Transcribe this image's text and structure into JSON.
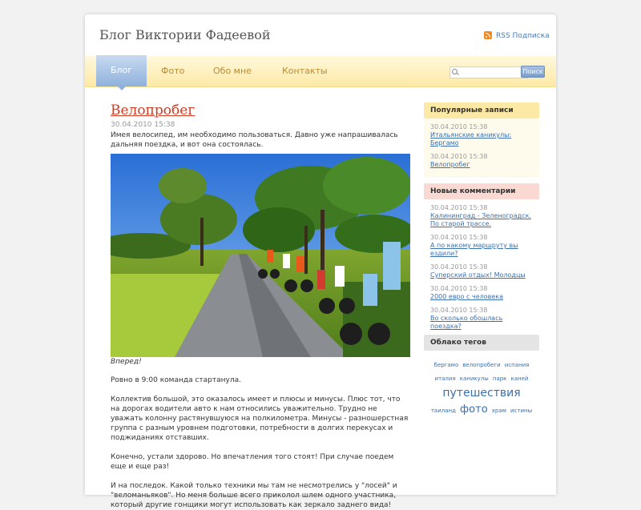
{
  "site": {
    "title": "Блог Виктории Фадеевой",
    "rss_label": "RSS Подписка"
  },
  "nav": {
    "items": [
      {
        "label": "Блог",
        "active": true
      },
      {
        "label": "Фото"
      },
      {
        "label": "Обо мне"
      },
      {
        "label": "Контакты"
      }
    ],
    "search_placeholder": "",
    "search_button": "Поиск"
  },
  "post": {
    "title": "Велопробег",
    "date": "30.04.2010 15:38",
    "intro": "Имея велосипед, им необходимо пользоваться. Давно уже напрашивалась дальняя поездка, и вот она состоялась.",
    "caption": "Вперед!",
    "paragraphs": [
      "Ровно в 9:00 команда стартанула.",
      "Коллектив большой, это оказалось имеет и плюсы и минусы. Плюс тот, что на дорогах водители авто к нам относились уважительно. Трудно не уважать колонну растянувшуюся на полкилометра. Минусы - разношерстная группа с разным уровнем подготовки, потребности в долгих перекусах и поджиданиях отставших.",
      "Конечно, устали здорово. Но впечатления того стоят! При случае поедем еще и еще раз!",
      "И на последок. Какой только техники мы там не несмотрелись у \"лосей\" и \"веломаньяков\". Но меня больше всего приколол шлем одного участника, который другие гонщики могут использовать как зеркало заднего вида!"
    ]
  },
  "popular": {
    "title": "Популярные записи",
    "items": [
      {
        "date": "30.04.2010 15:38",
        "link": "Итальянские каникулы: Бергамо"
      },
      {
        "date": "30.04.2010 15:38",
        "link": "Велопробег"
      }
    ]
  },
  "comments": {
    "title": "Новые комментарии",
    "items": [
      {
        "date": "30.04.2010 15:38",
        "link": "Калининград - Зеленоградск. По старой трассе."
      },
      {
        "date": "30.04.2010 15:38",
        "link": "А по какому маршруту вы ездили?"
      },
      {
        "date": "30.04.2010 15:38",
        "link": "Суперский отдых! Молодцы"
      },
      {
        "date": "30.04.2010 15:38",
        "link": "2000 евро с человека"
      },
      {
        "date": "30.04.2010 15:38",
        "link": "Во сколько обошлась поездка?"
      }
    ]
  },
  "tags": {
    "title": "Облако тегов",
    "items": [
      "бергамо",
      "велопробеги",
      "испания",
      "италия",
      "каникулы",
      "парк",
      "каней",
      "путешествия",
      "таиланд",
      "фото",
      "храм",
      "истины"
    ]
  },
  "colors": {
    "accent_red": "#d03b23",
    "link_blue": "#3a6fb0",
    "nav_yellow": "#fde9a6",
    "popular_head": "#fde9a6",
    "comments_head": "#f9d9d2",
    "tags_head": "#e4e4e4"
  }
}
